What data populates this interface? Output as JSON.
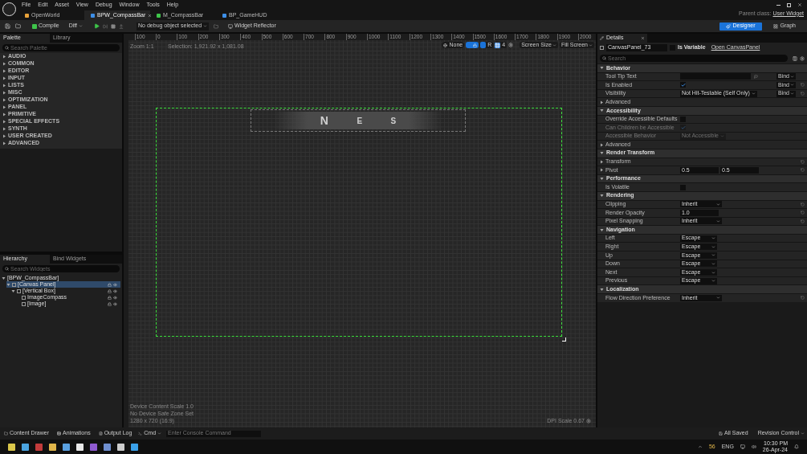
{
  "menu": [
    "File",
    "Edit",
    "Asset",
    "View",
    "Debug",
    "Window",
    "Tools",
    "Help"
  ],
  "doc_tabs": [
    {
      "label": "OpenWorld",
      "selected": false,
      "color": "#e8a23a"
    },
    {
      "label": "BPW_CompassBar",
      "selected": true,
      "color": "#3d8fe8"
    },
    {
      "label": "M_CompassBar",
      "selected": false,
      "color": "#3ec44a"
    },
    {
      "label": "BP_GameHUD",
      "selected": false,
      "color": "#3d8fe8"
    }
  ],
  "parent_class": {
    "label": "Parent class:",
    "value": "User Widget"
  },
  "toolbar": {
    "compile": "Compile",
    "diff": "Diff",
    "debug_object": "No debug object selected",
    "widget_reflector": "Widget Reflector"
  },
  "modes": [
    {
      "label": "Designer",
      "selected": true
    },
    {
      "label": "Graph",
      "selected": false
    }
  ],
  "palette": {
    "tabs": [
      {
        "label": "Palette",
        "selected": true
      },
      {
        "label": "Library",
        "selected": false
      }
    ],
    "search_placeholder": "Search Palette",
    "categories": [
      {
        "label": "AUDIO",
        "expanded": false
      },
      {
        "label": "COMMON",
        "expanded": false
      },
      {
        "label": "EDITOR",
        "expanded": false
      },
      {
        "label": "INPUT",
        "expanded": false
      },
      {
        "label": "LISTS",
        "expanded": false
      },
      {
        "label": "MISC",
        "expanded": false
      },
      {
        "label": "OPTIMIZATION",
        "expanded": false
      },
      {
        "label": "PANEL",
        "expanded": false
      },
      {
        "label": "PRIMITIVE",
        "expanded": false
      },
      {
        "label": "SPECIAL EFFECTS",
        "expanded": false
      },
      {
        "label": "SYNTH",
        "expanded": false
      },
      {
        "label": "USER CREATED",
        "expanded": false
      },
      {
        "label": "ADVANCED",
        "expanded": false
      }
    ]
  },
  "hierarchy": {
    "tabs": [
      {
        "label": "Hierarchy",
        "selected": true
      },
      {
        "label": "Bind Widgets",
        "selected": false
      }
    ],
    "search_placeholder": "Search Widgets",
    "tree": [
      {
        "label": "[BPW_CompassBar]",
        "selected": false,
        "expanded": true,
        "children": [
          {
            "label": "[Canvas Panel]",
            "selected": true,
            "expanded": true,
            "children": [
              {
                "label": "[Vertical Box]",
                "selected": false,
                "expanded": true,
                "children": [
                  {
                    "label": "ImageCompass",
                    "selected": false
                  },
                  {
                    "label": "[Image]",
                    "selected": false
                  }
                ]
              }
            ]
          }
        ]
      }
    ]
  },
  "canvas": {
    "zoom": "Zoom 1:1",
    "selection": "Selection: 1,921.92 x 1,081.08",
    "ruler": [
      "100",
      "0",
      "100",
      "200",
      "300",
      "400",
      "500",
      "600",
      "700",
      "800",
      "900",
      "1000",
      "1100",
      "1200",
      "1300",
      "1400",
      "1500",
      "1600",
      "1700",
      "1800",
      "1900",
      "2000"
    ],
    "toolbar": {
      "culture": "None",
      "lock_on": true,
      "respect_locks": "R",
      "respect_locks_on": true,
      "grid_snap": "4",
      "grid_snap_on": true,
      "screen_size": "Screen Size",
      "fill_screen": "Fill Screen"
    },
    "compass_letters": [
      "N",
      "E",
      "S"
    ],
    "info": [
      "Device Content Scale 1.0",
      "No Device Safe Zone Set",
      "1280 x 720 (16:9)"
    ],
    "dpi": "DPI Scale 0.67"
  },
  "details": {
    "tab": "Details",
    "widget_name": "CanvasPanel_73",
    "is_variable": {
      "label": "Is Variable",
      "checked": false
    },
    "open_link": "Open CanvasPanel",
    "search_placeholder": "Search",
    "sections": [
      {
        "title": "Behavior",
        "expanded": true,
        "rows": [
          {
            "kind": "text_field",
            "label": "Tool Tip Text",
            "bind": "Bind",
            "reset": false
          },
          {
            "kind": "checkbox",
            "label": "Is Enabled",
            "checked": true,
            "disabled": false,
            "bind": "Bind",
            "reset": true
          },
          {
            "kind": "dropdown",
            "label": "Visibility",
            "value": "Not Hit-Testable (Self Only)",
            "disabled": false,
            "bind": "Bind",
            "reset": true
          },
          {
            "kind": "expander",
            "label": "Advanced"
          }
        ]
      },
      {
        "title": "Accessibility",
        "expanded": true,
        "rows": [
          {
            "kind": "checkbox",
            "label": "Override Accessible Defaults",
            "checked": false,
            "disabled": false,
            "reset": false
          },
          {
            "kind": "checkbox",
            "label": "Can Children be Accessible",
            "checked": true,
            "disabled": true,
            "reset": false
          },
          {
            "kind": "dropdown",
            "label": "Accessible Behavior",
            "value": "Not Accessible",
            "disabled": true,
            "reset": false
          },
          {
            "kind": "expander",
            "label": "Advanced"
          }
        ]
      },
      {
        "title": "Render Transform",
        "expanded": true,
        "rows": [
          {
            "kind": "expander",
            "label": "Transform",
            "reset": true
          },
          {
            "kind": "pair",
            "label": "Pivot",
            "values": [
              "0.5",
              "0.5"
            ],
            "expandable": true,
            "reset": true
          }
        ]
      },
      {
        "title": "Performance",
        "expanded": true,
        "rows": [
          {
            "kind": "checkbox",
            "label": "Is Volatile",
            "checked": false,
            "disabled": false,
            "reset": false
          }
        ]
      },
      {
        "title": "Rendering",
        "expanded": true,
        "rows": [
          {
            "kind": "dropdown",
            "label": "Clipping",
            "value": "Inherit",
            "disabled": false,
            "reset": true
          },
          {
            "kind": "number",
            "label": "Render Opacity",
            "value": "1.0",
            "reset": true
          },
          {
            "kind": "dropdown",
            "label": "Pixel Snapping",
            "value": "Inherit",
            "disabled": false,
            "reset": true
          }
        ]
      },
      {
        "title": "Navigation",
        "expanded": true,
        "rows": [
          {
            "kind": "dropdown",
            "label": "Left",
            "value": "Escape",
            "disabled": false,
            "reset": false
          },
          {
            "kind": "dropdown",
            "label": "Right",
            "value": "Escape",
            "disabled": false,
            "reset": false
          },
          {
            "kind": "dropdown",
            "label": "Up",
            "value": "Escape",
            "disabled": false,
            "reset": false
          },
          {
            "kind": "dropdown",
            "label": "Down",
            "value": "Escape",
            "disabled": false,
            "reset": false
          },
          {
            "kind": "dropdown",
            "label": "Next",
            "value": "Escape",
            "disabled": false,
            "reset": false
          },
          {
            "kind": "dropdown",
            "label": "Previous",
            "value": "Escape",
            "disabled": false,
            "reset": false
          }
        ]
      },
      {
        "title": "Localization",
        "expanded": true,
        "rows": [
          {
            "kind": "dropdown",
            "label": "Flow Direction Preference",
            "value": "Inherit",
            "disabled": false,
            "reset": true
          }
        ]
      }
    ]
  },
  "status_bar": {
    "left": [
      "Content Drawer",
      "Animations",
      "Output Log"
    ],
    "cmd": "Cmd",
    "console_placeholder": "Enter Console Command",
    "saved": "All Saved",
    "revision": "Revision Control"
  },
  "taskbar": {
    "apps": [
      {
        "color": "#d9c64a"
      },
      {
        "color": "#4aa3df"
      },
      {
        "color": "#c23b3b"
      },
      {
        "color": "#e0b54a"
      },
      {
        "color": "#5aa0e0"
      },
      {
        "color": "#e8e8e8"
      },
      {
        "color": "#8f5ad0"
      },
      {
        "color": "#6f8fd0"
      },
      {
        "color": "#cccccc"
      },
      {
        "color": "#3aa0e8"
      }
    ],
    "tray_count": "56",
    "language": "ENG",
    "time": "10:30 PM",
    "date": "26-Apr-24"
  }
}
